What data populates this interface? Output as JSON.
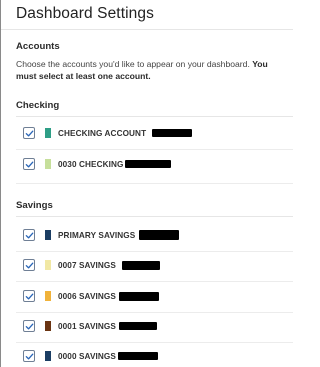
{
  "panel": {
    "title": "Dashboard Settings"
  },
  "accounts_section": {
    "heading": "Accounts",
    "description_plain": "Choose the accounts you'd like to appear on your dashboard. ",
    "description_bold": "You must select at least one account."
  },
  "groups": {
    "checking": {
      "heading": "Checking",
      "accounts": [
        {
          "label": "CHECKING ACCOUNT",
          "checked": true,
          "color": "#2e9e86"
        },
        {
          "label": "0030 CHECKING",
          "checked": true,
          "color": "#c6df9b"
        }
      ]
    },
    "savings": {
      "heading": "Savings",
      "accounts": [
        {
          "label": "PRIMARY SAVINGS",
          "checked": true,
          "color": "#1b3d63"
        },
        {
          "label": "0007 SAVINGS",
          "checked": true,
          "color": "#f1e8a4"
        },
        {
          "label": "0006 SAVINGS",
          "checked": true,
          "color": "#f0b23a"
        },
        {
          "label": "0001 SAVINGS",
          "checked": true,
          "color": "#6a3412"
        },
        {
          "label": "0000 SAVINGS",
          "checked": true,
          "color": "#1b3d63"
        }
      ]
    }
  },
  "icons": {
    "checkbox_check": "check-icon"
  },
  "colors": {
    "checkbox_border": "#6f7f95",
    "check_mark": "#2a66b8",
    "redaction": "#000000"
  }
}
